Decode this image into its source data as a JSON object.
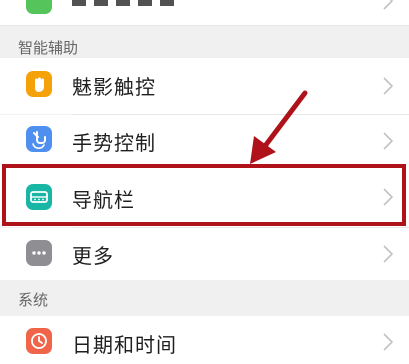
{
  "top_partial": {
    "icon": "green-app-icon"
  },
  "sections": {
    "smart_assist": {
      "title": "智能辅助"
    },
    "system": {
      "title": "系统"
    }
  },
  "items": [
    {
      "label": "魅影触控",
      "icon": "finger-touch-icon",
      "color": "#f5a20a"
    },
    {
      "label": "手势控制",
      "icon": "gesture-icon",
      "color": "#4f8ff0"
    },
    {
      "label": "导航栏",
      "icon": "navigation-bar-icon",
      "color": "#18b7a5"
    },
    {
      "label": "更多",
      "icon": "more-icon",
      "color": "#8e8e93"
    },
    {
      "label": "日期和时间",
      "icon": "clock-icon",
      "color": "#f0644a"
    }
  ],
  "annotation": {
    "highlight_color": "#b0121a",
    "highlighted_item": "导航栏"
  }
}
